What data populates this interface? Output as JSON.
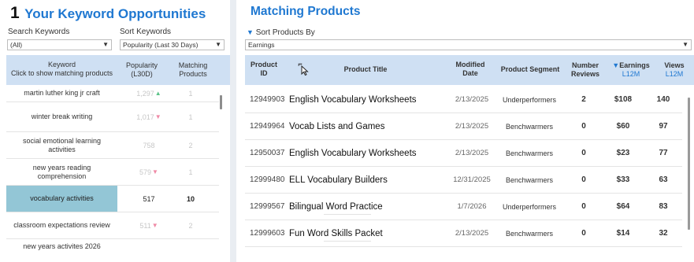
{
  "keywords": {
    "step_number": "1",
    "title": "Your Keyword Opportunities",
    "search_label": "Search Keywords",
    "search_value": "(All)",
    "sort_label": "Sort Keywords",
    "sort_value": "Popularity (Last 30 Days)",
    "columns": {
      "keyword": "Keyword",
      "keyword_hint": "Click to show matching products",
      "popularity": "Popularity",
      "popularity_sub": "(L30D)",
      "matching": "Matching",
      "matching_sub": "Products"
    },
    "rows": [
      {
        "keyword": "martin luther king jr craft",
        "popularity": "1,297",
        "trend": "up",
        "matching": "1",
        "selected": false
      },
      {
        "keyword": "winter break writing",
        "popularity": "1,017",
        "trend": "down",
        "matching": "1",
        "selected": false
      },
      {
        "keyword": "social emotional learning activities",
        "popularity": "758",
        "trend": "",
        "matching": "2",
        "selected": false
      },
      {
        "keyword": "new years reading comprehension",
        "popularity": "579",
        "trend": "down",
        "matching": "1",
        "selected": false
      },
      {
        "keyword": "vocabulary activities",
        "popularity": "517",
        "trend": "",
        "matching": "10",
        "selected": true
      },
      {
        "keyword": "classroom expectations review",
        "popularity": "511",
        "trend": "down",
        "matching": "2",
        "selected": false
      },
      {
        "keyword": "new years activites 2026",
        "popularity": "",
        "trend": "",
        "matching": "",
        "selected": false
      }
    ]
  },
  "products": {
    "title": "Matching Products",
    "sort_label": "Sort Products By",
    "sort_value": "Earnings",
    "columns": {
      "product_id": "Product",
      "product_id_2": "ID",
      "product_title": "Product Title",
      "modified": "Modified",
      "modified_2": "Date",
      "segment": "Product Segment",
      "reviews": "Number",
      "reviews_2": "Reviews",
      "earnings": "Earnings",
      "earnings_sub": "L12M",
      "views": "Views",
      "views_sub": "L12M"
    },
    "rows": [
      {
        "id": "12949903",
        "title": "English Vocabulary Worksheets",
        "date": "2/13/2025",
        "segment": "Underperformers",
        "reviews": "2",
        "earnings": "$108",
        "views": "140"
      },
      {
        "id": "12949964",
        "title": "Vocab Lists and Games",
        "date": "2/13/2025",
        "segment": "Benchwarmers",
        "reviews": "0",
        "earnings": "$60",
        "views": "97"
      },
      {
        "id": "12950037",
        "title": "English Vocabulary Worksheets",
        "date": "2/13/2025",
        "segment": "Benchwarmers",
        "reviews": "0",
        "earnings": "$23",
        "views": "77"
      },
      {
        "id": "12999480",
        "title": "ELL Vocabulary Builders",
        "date": "12/31/2025",
        "segment": "Benchwarmers",
        "reviews": "0",
        "earnings": "$33",
        "views": "63"
      },
      {
        "id": "12999567",
        "title": "Bilingual Word Practice",
        "date": "1/7/2026",
        "segment": "Underperformers",
        "reviews": "0",
        "earnings": "$64",
        "views": "83"
      },
      {
        "id": "12999603",
        "title": "Fun Word Skills Packet",
        "date": "2/13/2025",
        "segment": "Benchwarmers",
        "reviews": "0",
        "earnings": "$14",
        "views": "32"
      }
    ]
  },
  "colors": {
    "accent": "#1f78d1",
    "header_bg": "#cfe0f3",
    "selected_bg": "#93c6d6",
    "trend_up": "#5cc389",
    "trend_down": "#ef8aa6"
  },
  "icons": {
    "cursor": "pointer-cursor-icon",
    "sort_indicator": "sort-descending-icon",
    "dropdown": "chevron-down-icon"
  }
}
